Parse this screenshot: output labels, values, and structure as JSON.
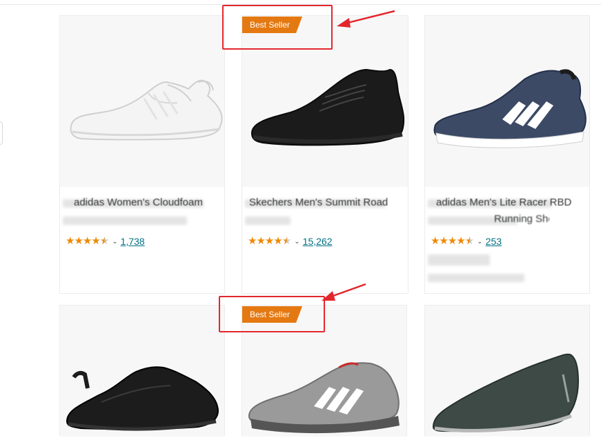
{
  "badges": {
    "best_seller": "Best Seller"
  },
  "products": [
    {
      "title": "adidas Women's Cloudfoam",
      "title_line2": "",
      "rating": 4.5,
      "review_count": "1,738"
    },
    {
      "title": "Skechers Men's Summit Road",
      "title_line2": "",
      "rating": 4.5,
      "review_count": "15,262"
    },
    {
      "title": "adidas Men's Lite Racer RBD",
      "title_line2": "Running Shoe",
      "rating": 4.5,
      "review_count": "253"
    },
    {
      "title": "",
      "title_line2": "",
      "rating": null,
      "review_count": ""
    },
    {
      "title": "",
      "title_line2": "",
      "rating": null,
      "review_count": ""
    },
    {
      "title": "",
      "title_line2": "",
      "rating": null,
      "review_count": ""
    }
  ],
  "icons": {
    "rating_star": "star-icon",
    "rating_dropdown": "chevron-down-icon",
    "annotation": "red-arrow-icon"
  },
  "colors": {
    "badge": "#e47911",
    "star": "#f08804",
    "link": "#007185",
    "annotation": "#e3262d"
  }
}
